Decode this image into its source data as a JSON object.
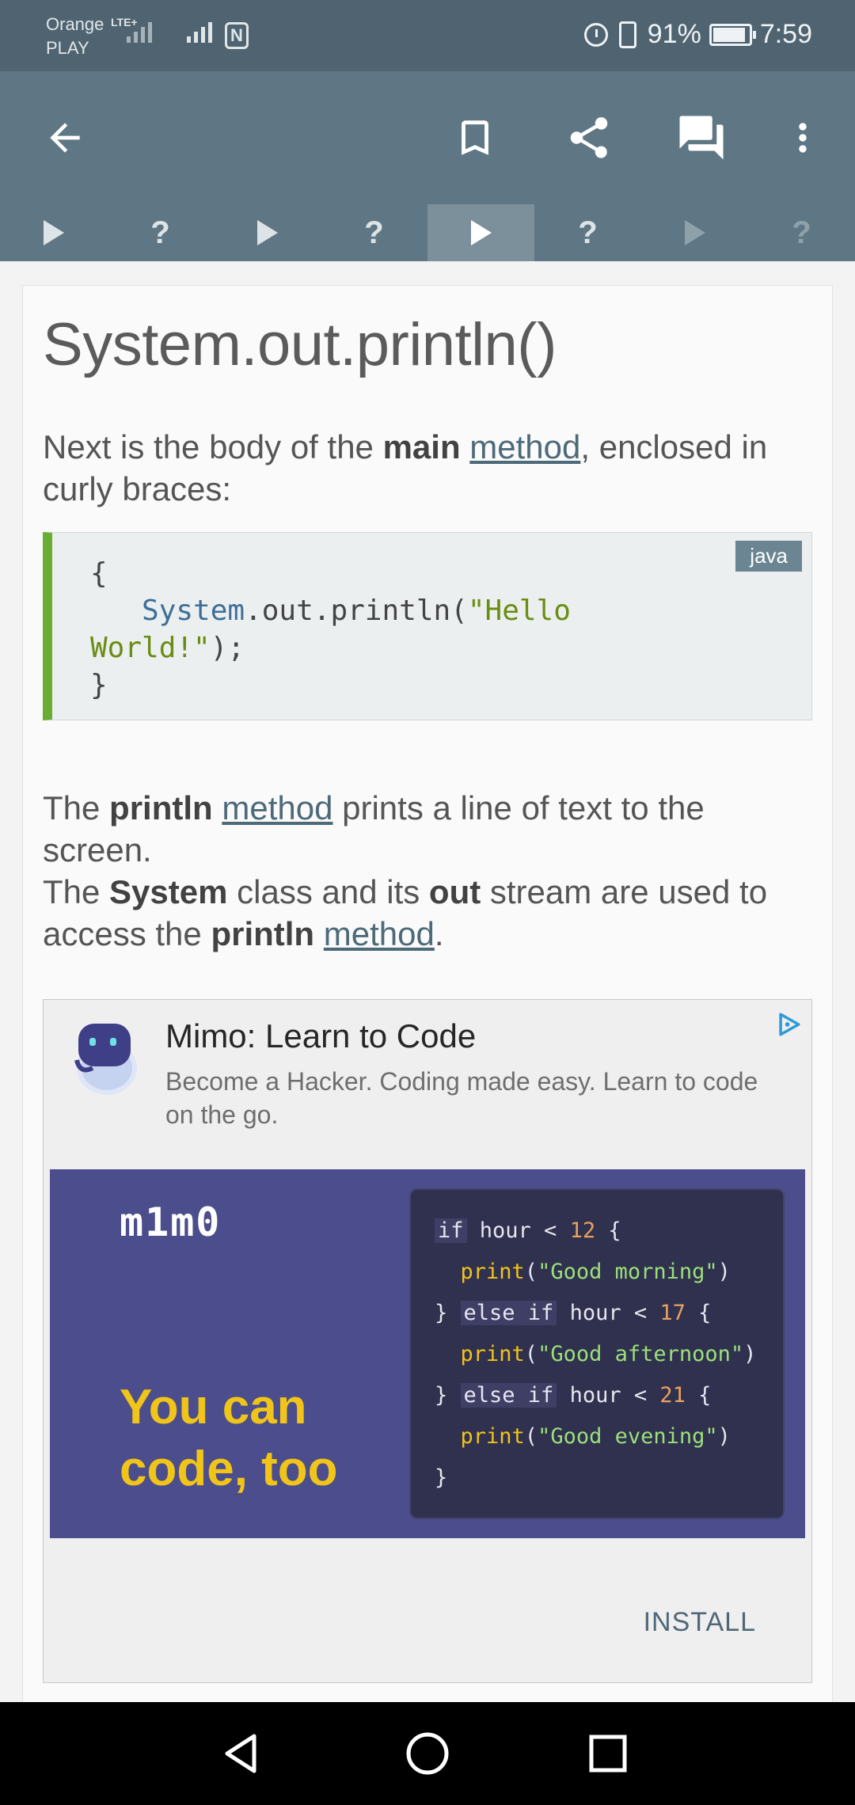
{
  "status_bar": {
    "carrier_line1": "Orange",
    "carrier_line2": "PLAY",
    "network_type": "LTE+",
    "battery_percent": "91%",
    "battery_level": 0.91,
    "time": "7:59",
    "nfc_label": "N"
  },
  "toolbar": {
    "icons": [
      "back-arrow-icon",
      "bookmark-icon",
      "share-icon",
      "comments-icon",
      "more-vert-icon"
    ]
  },
  "lesson_steps": [
    {
      "type": "lesson",
      "state": "done"
    },
    {
      "type": "quiz",
      "label": "?",
      "state": "done"
    },
    {
      "type": "lesson",
      "state": "done"
    },
    {
      "type": "quiz",
      "label": "?",
      "state": "done"
    },
    {
      "type": "lesson",
      "state": "active"
    },
    {
      "type": "quiz",
      "label": "?",
      "state": "upcoming"
    },
    {
      "type": "lesson",
      "state": "locked"
    },
    {
      "type": "quiz",
      "label": "?",
      "state": "locked"
    }
  ],
  "lesson": {
    "title": "System.out.println()",
    "p1": {
      "a": "Next is the body of the ",
      "b": "main",
      "c": " ",
      "link": "method",
      "d": ", enclosed in curly braces:"
    },
    "code": {
      "language": "java",
      "line1": "{",
      "line2_indent": "   ",
      "line2_class": "System",
      "line2_rest": ".out.println(",
      "line2_str": "\"Hello",
      "line3_str": "World!\"",
      "line3_rest": ");",
      "line4": "}"
    },
    "p2": {
      "a": "The ",
      "b": "println",
      "c": " ",
      "link1": "method",
      "d": " prints a line of text to the screen.",
      "e": "The ",
      "f": "System",
      "g": " class and its ",
      "h": "out",
      "i": " stream are used to access the ",
      "j": "println",
      "k": " ",
      "link2": "method",
      "l": "."
    }
  },
  "ad": {
    "title": "Mimo: Learn to Code",
    "description": "Become a Hacker. Coding made easy. Learn to code on the go.",
    "banner_logo": "m1m0",
    "banner_tagline_1": "You can",
    "banner_tagline_2": "code, too",
    "banner_code": {
      "l1_kw": "if",
      "l1_a": " hour < ",
      "l1_num": "12",
      "l1_b": " {",
      "l2_fn": "print",
      "l2_a": "(",
      "l2_s": "\"Good morning\"",
      "l2_b": ")",
      "l3_a": "} ",
      "l3_kw": "else if",
      "l3_b": " hour < ",
      "l3_num": "17",
      "l3_c": " {",
      "l4_fn": "print",
      "l4_a": "(",
      "l4_s": "\"Good afternoon\"",
      "l4_b": ")",
      "l5_a": "} ",
      "l5_kw": "else if",
      "l5_b": " hour < ",
      "l5_num": "21",
      "l5_c": " {",
      "l6_fn": "print",
      "l6_a": "(",
      "l6_s": "\"Good evening\"",
      "l6_b": ")",
      "l7": "}"
    },
    "install_label": "INSTALL"
  },
  "nav_bar": {
    "icons": [
      "nav-back-icon",
      "nav-home-icon",
      "nav-recents-icon"
    ]
  },
  "colors": {
    "toolbar": "#5f7784",
    "status_bar": "#4f6470",
    "code_accent": "#6aad33",
    "link": "#4d6a79",
    "ad_banner": "#4b4d8c",
    "banner_tagline": "#f0c419"
  }
}
